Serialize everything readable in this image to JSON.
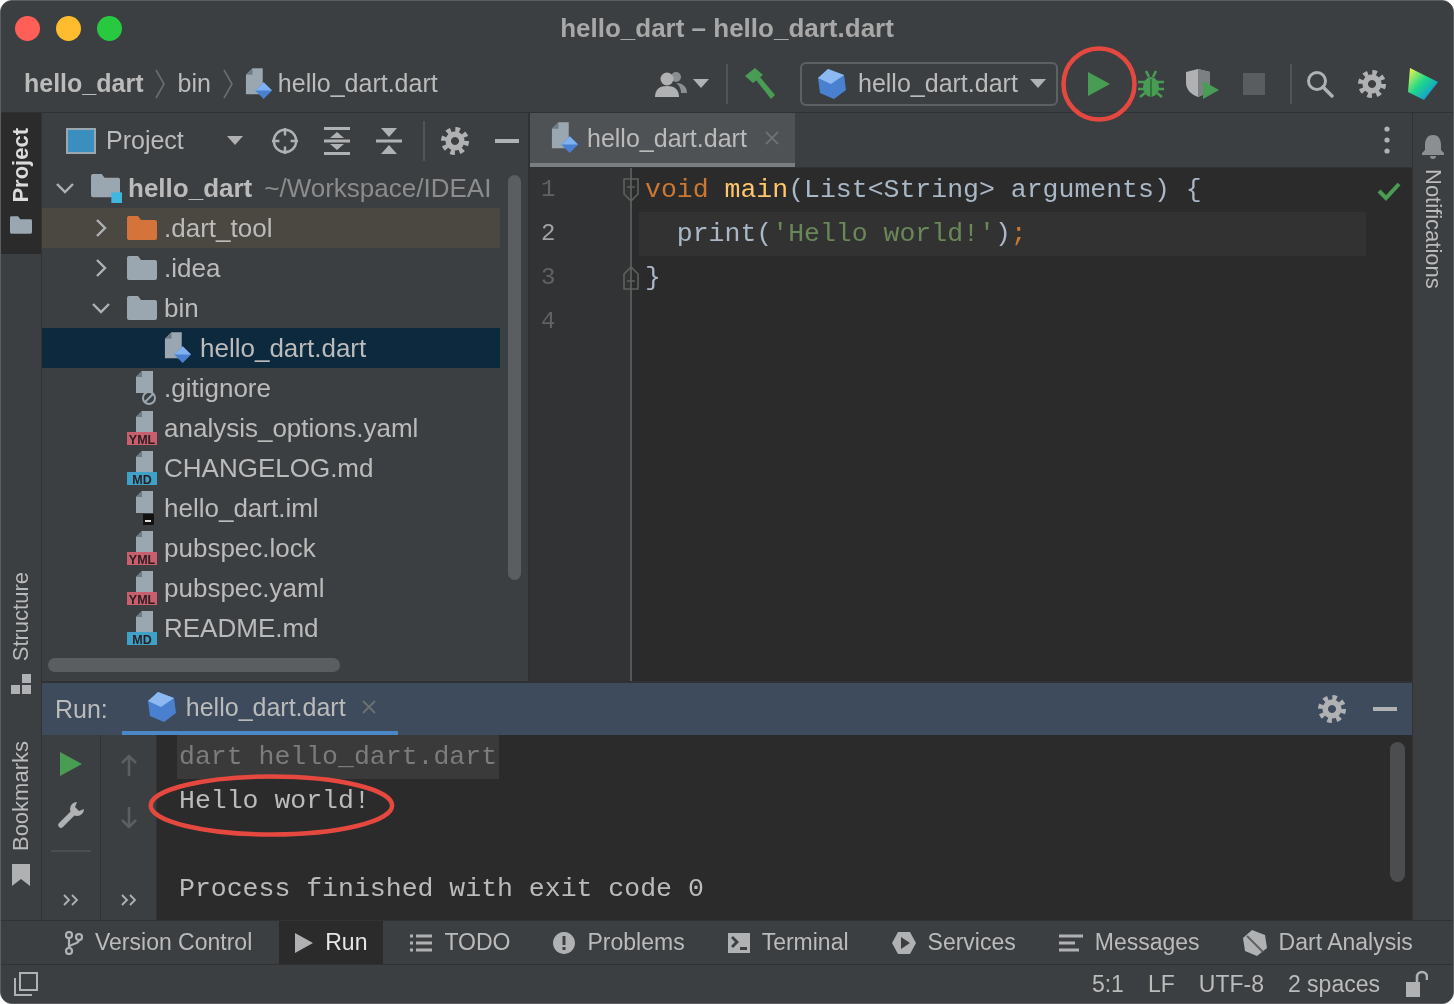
{
  "window": {
    "title": "hello_dart – hello_dart.dart"
  },
  "navigation_bar": {
    "breadcrumbs": [
      {
        "label": "hello_dart",
        "kind": "project"
      },
      {
        "label": "bin",
        "kind": "folder"
      },
      {
        "label": "hello_dart.dart",
        "kind": "dart"
      }
    ],
    "run_configuration": "hello_dart.dart",
    "run_button": {
      "annotated": true
    },
    "stop_button": {
      "disabled": true
    }
  },
  "tool_window_strips": {
    "left": [
      {
        "label": "Project",
        "kind": "project",
        "selected": true
      },
      {
        "label": "Structure",
        "kind": "structure",
        "selected": false
      },
      {
        "label": "Bookmarks",
        "kind": "bookmarks",
        "selected": false
      }
    ],
    "right": [
      {
        "label": "Notifications",
        "kind": "notifications",
        "selected": false
      }
    ]
  },
  "project_panel": {
    "title": "Project",
    "tree": [
      {
        "label": "hello_dart",
        "path": "~/Workspace/IDEAI",
        "kind": "project",
        "expanded": true,
        "selected": false,
        "children": [
          {
            "label": ".dart_tool",
            "kind": "excluded-folder",
            "expanded": false,
            "selected": false
          },
          {
            "label": ".idea",
            "kind": "folder",
            "expanded": false,
            "selected": false
          },
          {
            "label": "bin",
            "kind": "folder",
            "expanded": true,
            "selected": false,
            "children": [
              {
                "label": "hello_dart.dart",
                "kind": "dart",
                "selected": true
              }
            ]
          },
          {
            "label": ".gitignore",
            "kind": "ignore",
            "selected": false
          },
          {
            "label": "analysis_options.yaml",
            "kind": "yaml",
            "badge": "YML",
            "selected": false
          },
          {
            "label": "CHANGELOG.md",
            "kind": "markdown",
            "badge": "MD",
            "selected": false
          },
          {
            "label": "hello_dart.iml",
            "kind": "module",
            "selected": false
          },
          {
            "label": "pubspec.lock",
            "kind": "yaml",
            "badge": "YML",
            "selected": false
          },
          {
            "label": "pubspec.yaml",
            "kind": "yaml",
            "badge": "YML",
            "selected": false
          },
          {
            "label": "README.md",
            "kind": "markdown",
            "badge": "MD",
            "selected": false
          }
        ]
      }
    ]
  },
  "editor": {
    "tabs": [
      {
        "label": "hello_dart.dart",
        "selected": true
      }
    ],
    "analysis_ok": true,
    "lines": [
      {
        "number": "1",
        "fold_start": true,
        "fold_end": false,
        "current": false,
        "tokens": [
          {
            "text": "void ",
            "kind": "keyword"
          },
          {
            "text": "main",
            "kind": "function"
          },
          {
            "text": "(List<String> arguments) {",
            "kind": "plain"
          }
        ]
      },
      {
        "number": "2",
        "fold_start": false,
        "fold_end": false,
        "current": true,
        "tokens": [
          {
            "text": "  print(",
            "kind": "plain"
          },
          {
            "text": "'Hello world!'",
            "kind": "string"
          },
          {
            "text": ")",
            "kind": "plain"
          },
          {
            "text": ";",
            "kind": "keyword"
          }
        ]
      },
      {
        "number": "3",
        "fold_start": false,
        "fold_end": true,
        "current": false,
        "tokens": [
          {
            "text": "}",
            "kind": "plain"
          }
        ]
      },
      {
        "number": "4",
        "fold_start": false,
        "fold_end": false,
        "current": false
      }
    ]
  },
  "run_panel": {
    "title": "Run:",
    "tabs": [
      {
        "label": "hello_dart.dart",
        "selected": true
      }
    ],
    "console": [
      {
        "text": "dart hello_dart.dart",
        "kind": "command",
        "annotated": false
      },
      {
        "text": "Hello world!",
        "kind": "output",
        "annotated": true
      },
      {
        "kind": "blank"
      },
      {
        "text": "Process finished with exit code 0",
        "kind": "output",
        "annotated": false
      }
    ]
  },
  "tool_window_bar": [
    {
      "label": "Version Control",
      "kind": "vcs",
      "selected": false
    },
    {
      "label": "Run",
      "kind": "run",
      "selected": true
    },
    {
      "label": "TODO",
      "kind": "todo",
      "selected": false
    },
    {
      "label": "Problems",
      "kind": "problems",
      "selected": false
    },
    {
      "label": "Terminal",
      "kind": "terminal",
      "selected": false
    },
    {
      "label": "Services",
      "kind": "services",
      "selected": false
    },
    {
      "label": "Messages",
      "kind": "messages",
      "selected": false
    },
    {
      "label": "Dart Analysis",
      "kind": "dart-analysis",
      "selected": false
    }
  ],
  "status_bar": {
    "items": [
      "5:1",
      "LF",
      "UTF-8",
      "2 spaces"
    ],
    "read_only": false
  }
}
